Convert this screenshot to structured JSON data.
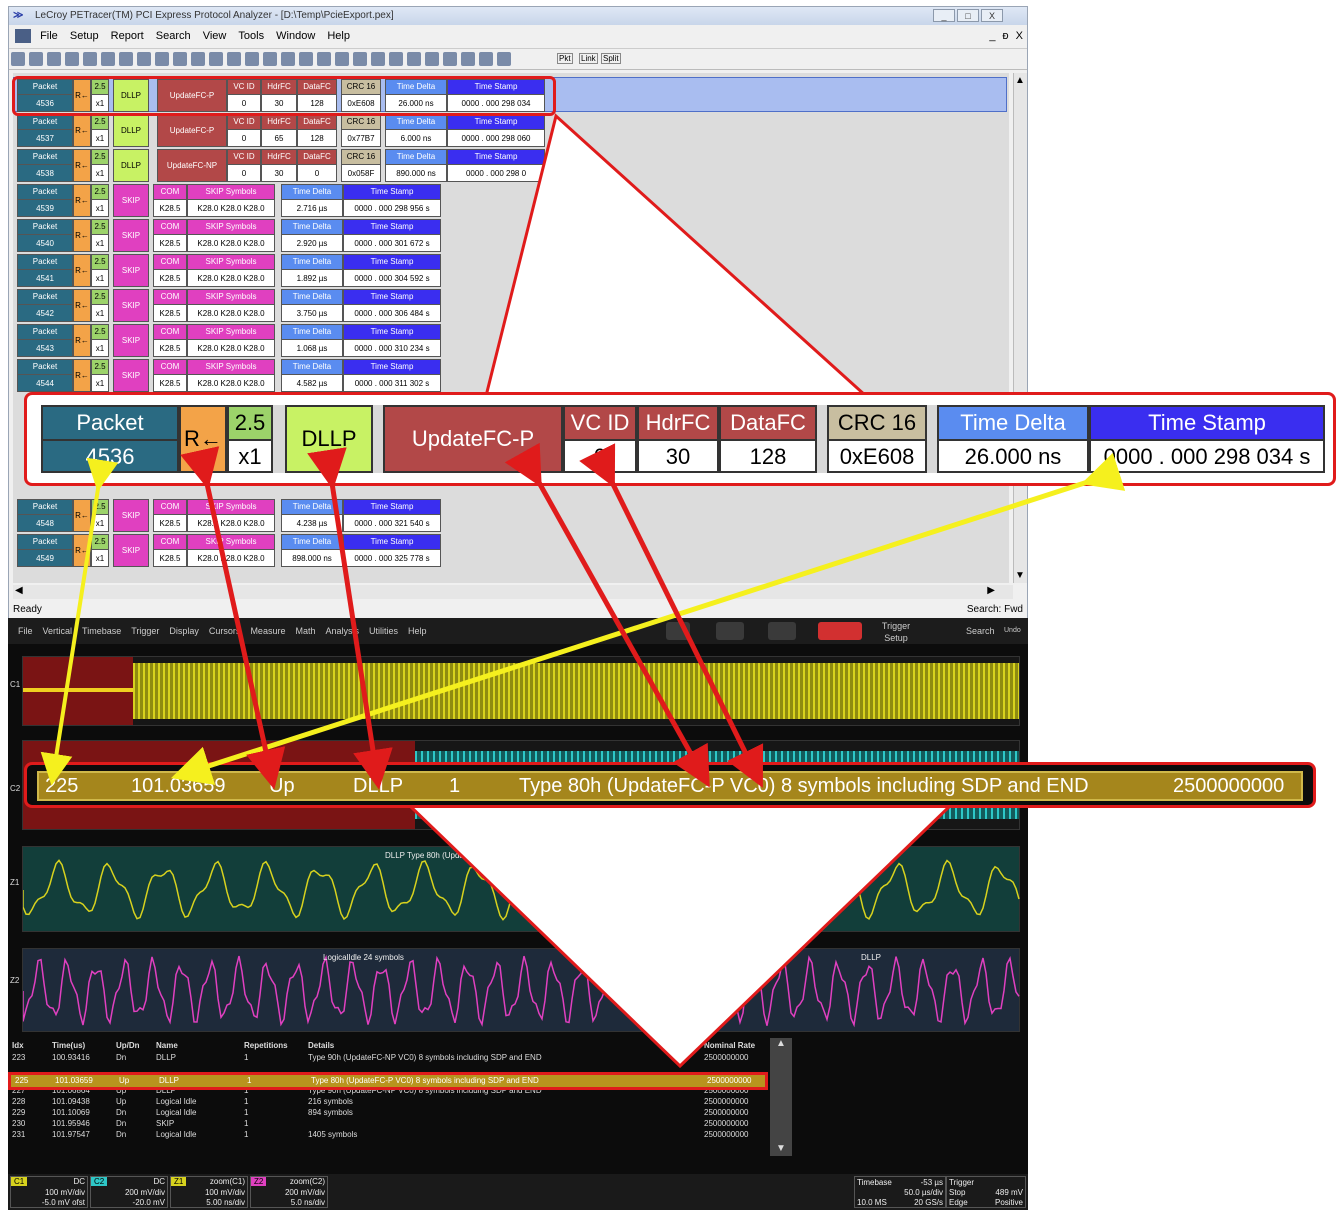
{
  "app": {
    "title": "LeCroy PETracer(TM) PCI Express Protocol Analyzer - [D:\\Temp\\PcieExport.pex]",
    "window_buttons": [
      "_",
      "□",
      "X"
    ],
    "mdi_buttons": [
      "_",
      "ᴆ",
      "X"
    ]
  },
  "menu": [
    "File",
    "Setup",
    "Report",
    "Search",
    "View",
    "Tools",
    "Window",
    "Help"
  ],
  "toolbar_labels": [
    "Pkt",
    "Link",
    "Split"
  ],
  "trace_rows": [
    {
      "packet": "4536",
      "dir": "R←",
      "speed": "2.5",
      "width": "x1",
      "kind": "DLLP",
      "type": "UpdateFC-P",
      "vc": "0",
      "hdr": "30",
      "data": "128",
      "crc": "0xE608",
      "td": "26.000 ns",
      "ts": "0000 . 000 298 034"
    },
    {
      "packet": "4537",
      "dir": "R←",
      "speed": "2.5",
      "width": "x1",
      "kind": "DLLP",
      "type": "UpdateFC-P",
      "vc": "0",
      "hdr": "65",
      "data": "128",
      "crc": "0x77B7",
      "td": "6.000 ns",
      "ts": "0000 . 000 298 060"
    },
    {
      "packet": "4538",
      "dir": "R←",
      "speed": "2.5",
      "width": "x1",
      "kind": "DLLP",
      "type": "UpdateFC-NP",
      "vc": "0",
      "hdr": "30",
      "data": "0",
      "crc": "0x058F",
      "td": "890.000 ns",
      "ts": "0000 . 000 298 0"
    },
    {
      "packet": "4539",
      "dir": "R←",
      "speed": "2.5",
      "width": "x1",
      "kind": "SKIP",
      "com": "K28.5",
      "skip": "K28.0 K28.0 K28.0",
      "td": "2.716 µs",
      "ts": "0000 . 000 298 956 s"
    },
    {
      "packet": "4540",
      "dir": "R←",
      "speed": "2.5",
      "width": "x1",
      "kind": "SKIP",
      "com": "K28.5",
      "skip": "K28.0 K28.0 K28.0",
      "td": "2.920 µs",
      "ts": "0000 . 000 301 672 s"
    },
    {
      "packet": "4541",
      "dir": "R←",
      "speed": "2.5",
      "width": "x1",
      "kind": "SKIP",
      "com": "K28.5",
      "skip": "K28.0 K28.0 K28.0",
      "td": "1.892 µs",
      "ts": "0000 . 000 304 592 s"
    },
    {
      "packet": "4542",
      "dir": "R←",
      "speed": "2.5",
      "width": "x1",
      "kind": "SKIP",
      "com": "K28.5",
      "skip": "K28.0 K28.0 K28.0",
      "td": "3.750 µs",
      "ts": "0000 . 000 306 484 s"
    },
    {
      "packet": "4543",
      "dir": "R←",
      "speed": "2.5",
      "width": "x1",
      "kind": "SKIP",
      "com": "K28.5",
      "skip": "K28.0 K28.0 K28.0",
      "td": "1.068 µs",
      "ts": "0000 . 000 310 234 s"
    },
    {
      "packet": "4544",
      "dir": "R←",
      "speed": "2.5",
      "width": "x1",
      "kind": "SKIP",
      "com": "K28.5",
      "skip": "K28.0 K28.0 K28.0",
      "td": "4.582 µs",
      "ts": "0000 . 000 311 302 s"
    },
    {
      "packet": "4548",
      "dir": "R←",
      "speed": "2.5",
      "width": "x1",
      "kind": "SKIP",
      "com": "K28.5",
      "skip": "K28.0 K28.0 K28.0",
      "td": "4.238 µs",
      "ts": "0000 . 000 321 540 s"
    },
    {
      "packet": "4549",
      "dir": "R←",
      "speed": "2.5",
      "width": "x1",
      "kind": "SKIP",
      "com": "K28.5",
      "skip": "K28.0 K28.0 K28.0",
      "td": "898.000 ns",
      "ts": "0000 . 000 325 778 s"
    }
  ],
  "headers": {
    "packet": "Packet",
    "vc": "VC ID",
    "hdr": "HdrFC",
    "data": "DataFC",
    "crc": "CRC 16",
    "td": "Time Delta",
    "ts": "Time Stamp",
    "com": "COM",
    "skip": "SKIP Symbols"
  },
  "status": {
    "left": "Ready",
    "right": "Search: Fwd"
  },
  "zoom": {
    "packet": "Packet",
    "packet_no": "4536",
    "dir": "R←",
    "speed": "2.5",
    "width": "x1",
    "kind": "DLLP",
    "type": "UpdateFC-P",
    "vc_h": "VC ID",
    "vc": "0",
    "hdr_h": "HdrFC",
    "hdr": "30",
    "data_h": "DataFC",
    "data": "128",
    "crc_h": "CRC 16",
    "crc": "0xE608",
    "td_h": "Time Delta",
    "td": "26.000 ns",
    "ts_h": "Time Stamp",
    "ts": "0000 . 000 298 034 s"
  },
  "scope": {
    "menu": [
      "File",
      "Vertical",
      "Timebase",
      "Trigger",
      "Display",
      "Cursors",
      "Measure",
      "Math",
      "Analysis",
      "Utilities",
      "Help"
    ],
    "trigger_setup": "Trigger Setup",
    "search": "Search",
    "undo": "Undo",
    "dllp_label": "DLLP Type 80h (UpdateFC-P VC",
    "logical_idle_label": "LogicalIdle 24 symbols",
    "dllp_short": "DLLP",
    "decode": {
      "idx": "225",
      "time": "101.03659",
      "dir": "Up",
      "name": "DLLP",
      "rep": "1",
      "details": "Type 80h (UpdateFC-P VC0) 8 symbols including SDP and END",
      "rate": "2500000000"
    },
    "table_headers": {
      "idx": "Idx",
      "time": "Time(us)",
      "updn": "Up/Dn",
      "name": "Name",
      "rep": "Repetitions",
      "details": "Details",
      "rate": "Nominal Rate"
    },
    "table_rows": [
      {
        "idx": "223",
        "time": "100.93416",
        "updn": "Dn",
        "name": "DLLP",
        "rep": "1",
        "details": "Type 90h (UpdateFC-NP VC0) 8 symbols including SDP and END",
        "rate": "2500000000"
      },
      {
        "idx": "225",
        "time": "101.03659",
        "updn": "Up",
        "name": "DLLP",
        "rep": "1",
        "details": "Type 80h (UpdateFC-P VC0) 8 symbols including SDP and END",
        "rate": "2500000000"
      },
      {
        "idx": "227",
        "time": "101.06864",
        "updn": "Up",
        "name": "DLLP",
        "rep": "1",
        "details": "Type 90h (UpdateFC-NP VC0) 8 symbols including SDP and END",
        "rate": "2500000000"
      },
      {
        "idx": "228",
        "time": "101.09438",
        "updn": "Up",
        "name": "Logical Idle",
        "rep": "1",
        "details": "216 symbols",
        "rate": "2500000000"
      },
      {
        "idx": "229",
        "time": "101.10069",
        "updn": "Dn",
        "name": "Logical Idle",
        "rep": "1",
        "details": "894 symbols",
        "rate": "2500000000"
      },
      {
        "idx": "230",
        "time": "101.95946",
        "updn": "Dn",
        "name": "SKIP",
        "rep": "1",
        "details": "",
        "rate": "2500000000"
      },
      {
        "idx": "231",
        "time": "101.97547",
        "updn": "Dn",
        "name": "Logical Idle",
        "rep": "1",
        "details": "1405 symbols",
        "rate": "2500000000"
      }
    ],
    "channels": [
      {
        "name": "C1",
        "tag": "DC",
        "scale": "100 mV/div",
        "offset": "-5.0 mV ofst",
        "color": "#d7d21e"
      },
      {
        "name": "C2",
        "tag": "DC",
        "scale": "200 mV/div",
        "offset": "-20.0 mV",
        "color": "#2ec7c7"
      },
      {
        "name": "Z1",
        "tag": "zoom(C1)",
        "scale": "100 mV/div",
        "offset": "5.00 ns/div",
        "color": "#d7d21e"
      },
      {
        "name": "Z2",
        "tag": "zoom(C2)",
        "scale": "200 mV/div",
        "offset": "5.0 ns/div",
        "color": "#e040c0"
      }
    ],
    "timebase": {
      "label": "Timebase",
      "delay": "-53 µs",
      "div": "50.0 µs/div",
      "samples": "10.0 MS",
      "rate": "20 GS/s"
    },
    "trigger": {
      "label": "Trigger",
      "mode": "Stop",
      "type": "Edge",
      "level": "489 mV",
      "slope": "Positive"
    }
  }
}
